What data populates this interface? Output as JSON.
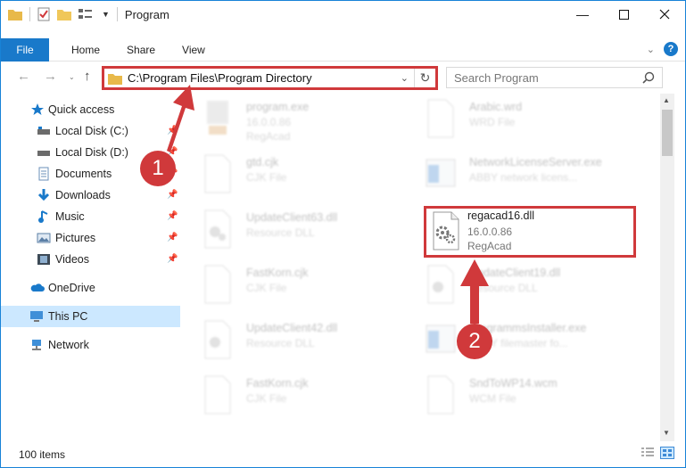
{
  "titlebar": {
    "title": "Program"
  },
  "ribbon": {
    "file": "File",
    "tabs": [
      "Home",
      "Share",
      "View"
    ],
    "help": "?"
  },
  "nav": {
    "address": "C:\\Program Files\\Program Directory",
    "search_placeholder": "Search Program"
  },
  "sidebar": {
    "items": [
      {
        "label": "Quick access",
        "icon": "star-icon"
      },
      {
        "label": "Local Disk (C:)",
        "icon": "drive-icon"
      },
      {
        "label": "Local Disk (D:)",
        "icon": "drive-icon"
      },
      {
        "label": "Documents",
        "icon": "documents-icon"
      },
      {
        "label": "Downloads",
        "icon": "download-icon"
      },
      {
        "label": "Music",
        "icon": "music-icon"
      },
      {
        "label": "Pictures",
        "icon": "pictures-icon"
      },
      {
        "label": "Videos",
        "icon": "videos-icon"
      },
      {
        "label": "OneDrive",
        "icon": "cloud-icon"
      },
      {
        "label": "This PC",
        "icon": "computer-icon"
      },
      {
        "label": "Network",
        "icon": "network-icon"
      }
    ]
  },
  "files": [
    {
      "name": "program.exe",
      "line1": "16.0.0.86",
      "line2": "RegAcad",
      "icon": "exe-icon"
    },
    {
      "name": "Arabic.wrd",
      "line1": "WRD File",
      "line2": "",
      "icon": "file-icon"
    },
    {
      "name": "gtd.cjk",
      "line1": "CJK File",
      "line2": "",
      "icon": "file-icon"
    },
    {
      "name": "NetworkLicenseServer.exe",
      "line1": "ABBY network licens...",
      "line2": "",
      "icon": "app-icon"
    },
    {
      "name": "UpdateClient63.dll",
      "line1": "Resource DLL",
      "line2": "",
      "icon": "dll-icon"
    },
    {
      "name": "regacad16.dll",
      "line1": "16.0.0.86",
      "line2": "RegAcad",
      "icon": "dll-icon"
    },
    {
      "name": "FastKorn.cjk",
      "line1": "CJK File",
      "line2": "",
      "icon": "file-icon"
    },
    {
      "name": "UpdateClient19.dll",
      "line1": "Resource DLL",
      "line2": "",
      "icon": "dll-icon"
    },
    {
      "name": "UpdateClient42.dll",
      "line1": "Resource DLL",
      "line2": "",
      "icon": "dll-icon"
    },
    {
      "name": "ProgrammsInstaller.exe",
      "line1": "ABBY filemaster fo...",
      "line2": "",
      "icon": "app-icon"
    },
    {
      "name": "FastKorn.cjk",
      "line1": "CJK File",
      "line2": "",
      "icon": "file-icon"
    },
    {
      "name": "SndToWP14.wcm",
      "line1": "WCM File",
      "line2": "",
      "icon": "file-icon"
    }
  ],
  "status": {
    "count": "100 items"
  },
  "annotations": {
    "step1": "1",
    "step2": "2"
  },
  "colors": {
    "accent": "#1979ca",
    "highlight": "#d0393b",
    "selected": "#cce8ff"
  }
}
